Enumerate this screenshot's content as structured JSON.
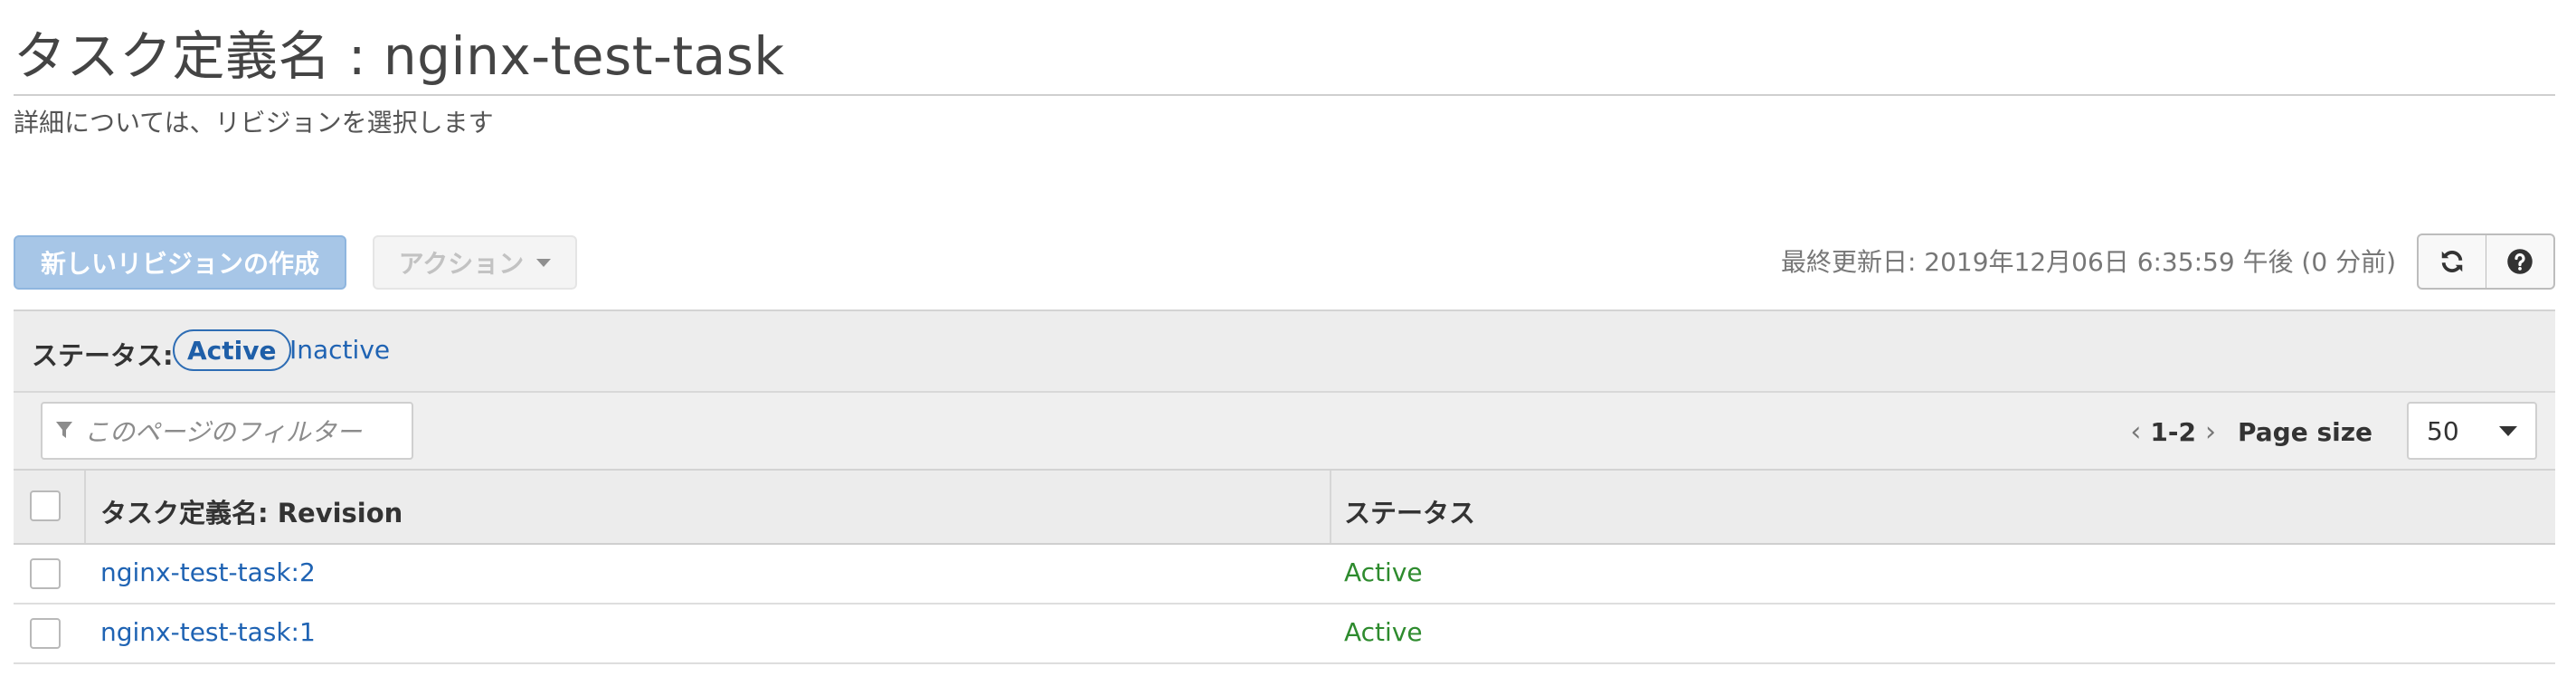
{
  "header": {
    "title": "タスク定義名 : nginx-test-task",
    "subtitle": "詳細については、リビジョンを選択します"
  },
  "toolbar": {
    "create_revision_label": "新しいリビジョンの作成",
    "actions_label": "アクション",
    "last_updated": "最終更新日: 2019年12月06日 6:35:59 午後 (0 分前)",
    "refresh_icon": "refresh-icon",
    "help_icon": "help-icon"
  },
  "status_filter": {
    "label": "ステータス:",
    "options": [
      "Active",
      "Inactive"
    ],
    "selected": "Active"
  },
  "filter": {
    "placeholder": "このページのフィルター"
  },
  "pagination": {
    "range": "1-2",
    "page_size_label": "Page size",
    "page_size_value": "50"
  },
  "table": {
    "columns": [
      "タスク定義名: Revision",
      "ステータス"
    ],
    "rows": [
      {
        "revision": "nginx-test-task:2",
        "status": "Active"
      },
      {
        "revision": "nginx-test-task:1",
        "status": "Active"
      }
    ]
  },
  "colors": {
    "link": "#1f63b3",
    "active_status": "#2e8b2e",
    "primary_button": "#a7c6e7"
  }
}
